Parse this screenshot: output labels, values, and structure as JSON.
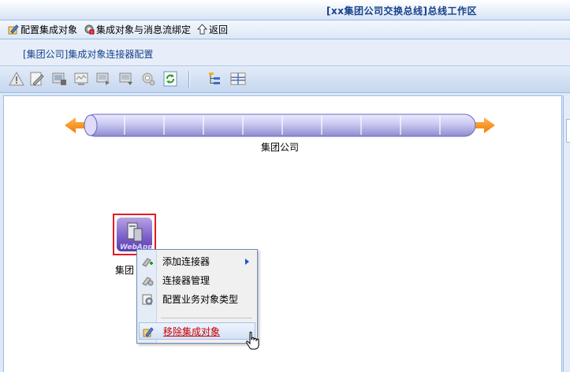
{
  "header": {
    "title": "[xx集团公司交换总线]总线工作区"
  },
  "nav": {
    "config_label": "配置集成对象",
    "bind_label": "集成对象与消息流绑定",
    "back_label": "返回"
  },
  "breadcrumb": {
    "text": "[集团公司]集成对象连接器配置"
  },
  "toolbar": {
    "icons": [
      "warning-icon",
      "edit-icon",
      "import-icon",
      "monitor-icon",
      "export-icon",
      "download-icon",
      "settings-icon",
      "refresh-icon",
      "tree-icon",
      "layout-icon"
    ]
  },
  "diagram": {
    "bus_label": "集团公司",
    "node_label": "集团",
    "node_badge": "WebApp"
  },
  "context_menu": {
    "items": [
      {
        "label": "添加连接器",
        "has_submenu": true
      },
      {
        "label": "连接器管理"
      },
      {
        "label": "配置业务对象类型"
      },
      {
        "label": "移除集成对象",
        "active": true
      }
    ]
  },
  "colors": {
    "accent": "#15428b",
    "bus_arrow": "#f7941d",
    "bus_body": "#c9c8f0",
    "selection_border": "#e11b22",
    "menu_active_text": "#cc0000"
  }
}
